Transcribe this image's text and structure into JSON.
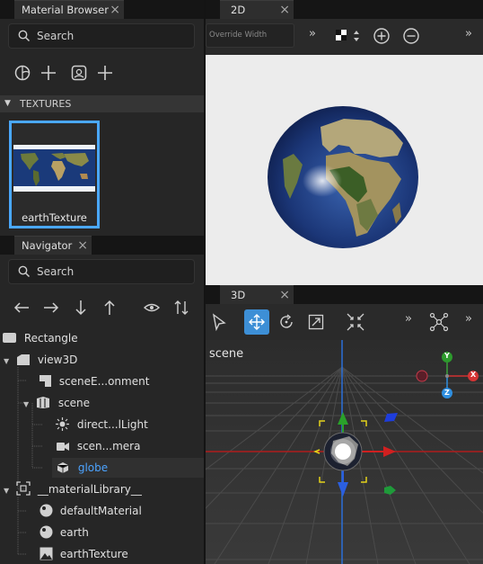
{
  "material_browser": {
    "tab_title": "Material Browser",
    "search_placeholder": "Search",
    "section_title": "TEXTURES",
    "texture_label": "earthTexture"
  },
  "navigator": {
    "tab_title": "Navigator",
    "search_placeholder": "Search",
    "tree": [
      {
        "label": "Rectangle",
        "icon": "rectangle-icon"
      },
      {
        "label": "view3D",
        "icon": "view3d-icon"
      },
      {
        "label": "sceneE...onment",
        "icon": "scene-environment-icon"
      },
      {
        "label": "scene",
        "icon": "scene-icon"
      },
      {
        "label": "direct...lLight",
        "icon": "light-icon"
      },
      {
        "label": "scen...mera",
        "icon": "camera-icon"
      },
      {
        "label": "globe",
        "icon": "model-icon",
        "selected": true
      },
      {
        "label": "__materialLibrary__",
        "icon": "material-library-icon"
      },
      {
        "label": "defaultMaterial",
        "icon": "material-icon"
      },
      {
        "label": "earth",
        "icon": "material-icon"
      },
      {
        "label": "earthTexture",
        "icon": "texture-icon"
      }
    ]
  },
  "view2d": {
    "tab_title": "2D",
    "override_width_placeholder": "Override Width",
    "more_label": "»"
  },
  "view3d": {
    "tab_title": "3D",
    "scene_label": "scene",
    "more_label": "»"
  },
  "gizmo_axes": {
    "x": "X",
    "y": "Y",
    "z": "Z"
  },
  "colors": {
    "accent": "#4ca3ff",
    "selected_tool": "#3d8fd6",
    "texture_border": "#4aa8ff"
  }
}
